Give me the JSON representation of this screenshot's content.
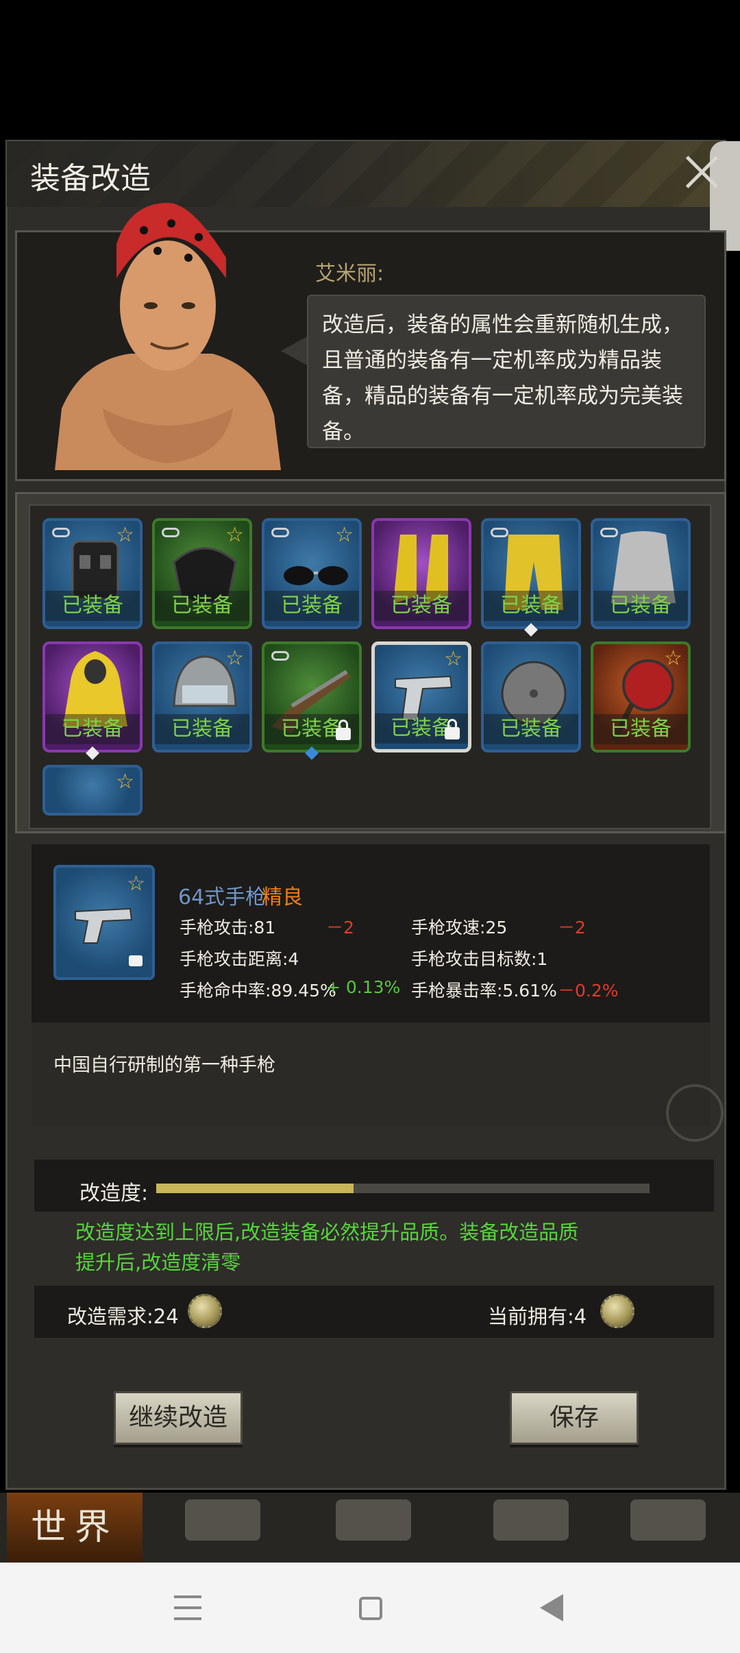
{
  "dialog": {
    "title": "装备改造",
    "npc_name": "艾米丽:",
    "npc_speech": "改造后，装备的属性会重新随机生成，且普通的装备有一定机率成为精品装备，精品的装备有一定机率成为完美装备。"
  },
  "inventory": {
    "equipped_label": "已装备",
    "slots": [
      {
        "item": "vest-icon",
        "rarity": "blue",
        "star": true,
        "link": true,
        "equipped": true
      },
      {
        "item": "mask-icon",
        "rarity": "green",
        "star": true,
        "link": true,
        "equipped": true
      },
      {
        "item": "sunglasses-icon",
        "rarity": "blue",
        "star": true,
        "link": true,
        "equipped": true
      },
      {
        "item": "boots-icon",
        "rarity": "purple",
        "star": false,
        "link": false,
        "equipped": true
      },
      {
        "item": "pants-icon",
        "rarity": "blue",
        "star": false,
        "link": true,
        "equipped": true
      },
      {
        "item": "shirt-icon",
        "rarity": "blue",
        "star": false,
        "link": true,
        "equipped": true
      },
      {
        "item": "raincoat-icon",
        "rarity": "purple",
        "star": false,
        "link": false,
        "equipped": true
      },
      {
        "item": "helmet-icon",
        "rarity": "blue",
        "star": true,
        "link": false,
        "equipped": true
      },
      {
        "item": "shotgun-icon",
        "rarity": "green",
        "star": false,
        "link": true,
        "equipped": true,
        "locked": true
      },
      {
        "item": "pistol-icon",
        "rarity": "blue",
        "star": true,
        "link": false,
        "equipped": true,
        "locked": true,
        "selected": true
      },
      {
        "item": "shield-icon",
        "rarity": "blue",
        "star": false,
        "link": false,
        "equipped": true
      },
      {
        "item": "frying-pan-icon",
        "rarity": "orange",
        "star": true,
        "link": false,
        "equipped": true
      },
      {
        "item": "stick-icon",
        "rarity": "blue",
        "star": true,
        "link": false,
        "equipped": false
      }
    ]
  },
  "item_detail": {
    "name": "64式手枪",
    "quality": "精良",
    "stats": {
      "attack": "手枪攻击:81",
      "attack_delta": "－2",
      "speed": "手枪攻速:25",
      "speed_delta": "－2",
      "range": "手枪攻击距离:4",
      "targets": "手枪攻击目标数:1",
      "hit": "手枪命中率:89.45%",
      "hit_delta": "+ 0.13%",
      "crit": "手枪暴击率:5.61%",
      "crit_delta": "－0.2%"
    },
    "description": "中国自行研制的第一种手枪"
  },
  "modify": {
    "progress_label": "改造度:",
    "progress": 0.4,
    "hint": "改造度达到上限后,改造装备必然提升品质。装备改造品质提升后,改造度清零",
    "cost_label": "改造需求:24",
    "own_label": "当前拥有:4",
    "coin_icon": "bottle-cap-icon"
  },
  "buttons": {
    "continue": "继续改造",
    "save": "保存"
  },
  "bottom_nav": {
    "world": "世界"
  },
  "colors": {
    "equipped_text": "#7fd24a",
    "hint_text": "#57d63c",
    "quality_text": "#f07c18",
    "negative_delta": "#e23a2a",
    "positive_delta": "#58c83c"
  }
}
